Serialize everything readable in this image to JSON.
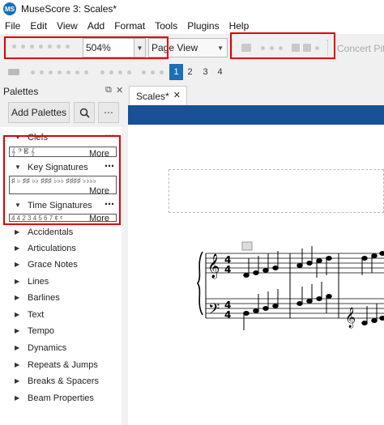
{
  "window": {
    "title": "MuseScore 3: Scales*",
    "app_icon": "MS"
  },
  "menu": [
    {
      "label": "File"
    },
    {
      "label": "Edit"
    },
    {
      "label": "View"
    },
    {
      "label": "Add"
    },
    {
      "label": "Format"
    },
    {
      "label": "Tools"
    },
    {
      "label": "Plugins"
    },
    {
      "label": "Help"
    }
  ],
  "toolbar": {
    "zoom_value": "504%",
    "view_mode": "Page View",
    "concert_pitch": "Concert Pitch"
  },
  "voices": [
    "1",
    "2",
    "3",
    "4"
  ],
  "palettes": {
    "title": "Palettes",
    "add_button": "Add Palettes",
    "search_icon": "search-icon",
    "more_dots": "⋯",
    "expanded": [
      {
        "name": "Clefs",
        "more": "More",
        "glyphs": "𝄞 𝄢 𝄡 𝄞"
      },
      {
        "name": "Key Signatures",
        "more": "More",
        "glyphs": "♯ ♭ ♯♯ ♭♭ ♯♯♯ ♭♭♭ ♯♯♯♯ ♭♭♭♭"
      },
      {
        "name": "Time Signatures",
        "more": "More",
        "glyphs": "4 4 2 3 4 5 6 7 ¢ 𝄴"
      }
    ],
    "collapsed": [
      "Accidentals",
      "Articulations",
      "Grace Notes",
      "Lines",
      "Barlines",
      "Text",
      "Tempo",
      "Dynamics",
      "Repeats & Jumps",
      "Breaks & Spacers",
      "Beam Properties"
    ]
  },
  "score": {
    "tab_label": "Scales*"
  },
  "colors": {
    "accent": "#1a6fb5",
    "band": "#1a5096",
    "highlight": "#e00000"
  }
}
